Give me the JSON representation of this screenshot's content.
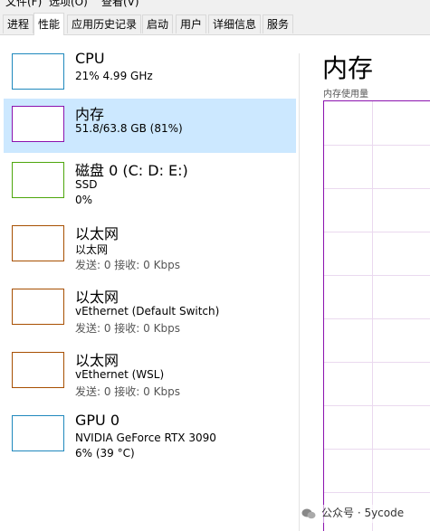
{
  "menu": {
    "items": [
      "文件(F)",
      "选项(O)",
      "查看(V)"
    ]
  },
  "tabs": [
    "进程",
    "性能",
    "应用历史记录",
    "启动",
    "用户",
    "详细信息",
    "服务"
  ],
  "active_tab": "性能",
  "items": [
    {
      "title": "CPU",
      "line1": "21%  4.99 GHz",
      "line2": "",
      "color": "#1f88bd"
    },
    {
      "title": "内存",
      "line1": "51.8/63.8 GB (81%)",
      "line2": "",
      "color": "#8b12ae"
    },
    {
      "title": "磁盘 0 (C: D: E:)",
      "line1": "SSD",
      "line2": "0%",
      "color": "#4da60c"
    },
    {
      "title": "以太网",
      "line1": "以太网",
      "line2": "发送: 0  接收: 0 Kbps",
      "color": "#a74f01"
    },
    {
      "title": "以太网",
      "line1": "vEthernet (Default Switch)",
      "line2": "发送: 0  接收: 0 Kbps",
      "color": "#a74f01"
    },
    {
      "title": "以太网",
      "line1": "vEthernet (WSL)",
      "line2": "发送: 0  接收: 0 Kbps",
      "color": "#a74f01"
    },
    {
      "title": "GPU 0",
      "line1": "NVIDIA GeForce RTX 3090",
      "line2": "6%  (39 °C)",
      "color": "#1f88bd"
    }
  ],
  "selected_index": 1,
  "detail": {
    "title": "内存",
    "subtitle": "内存使用量"
  },
  "watermark": {
    "text": "公众号 · 5ycode"
  }
}
